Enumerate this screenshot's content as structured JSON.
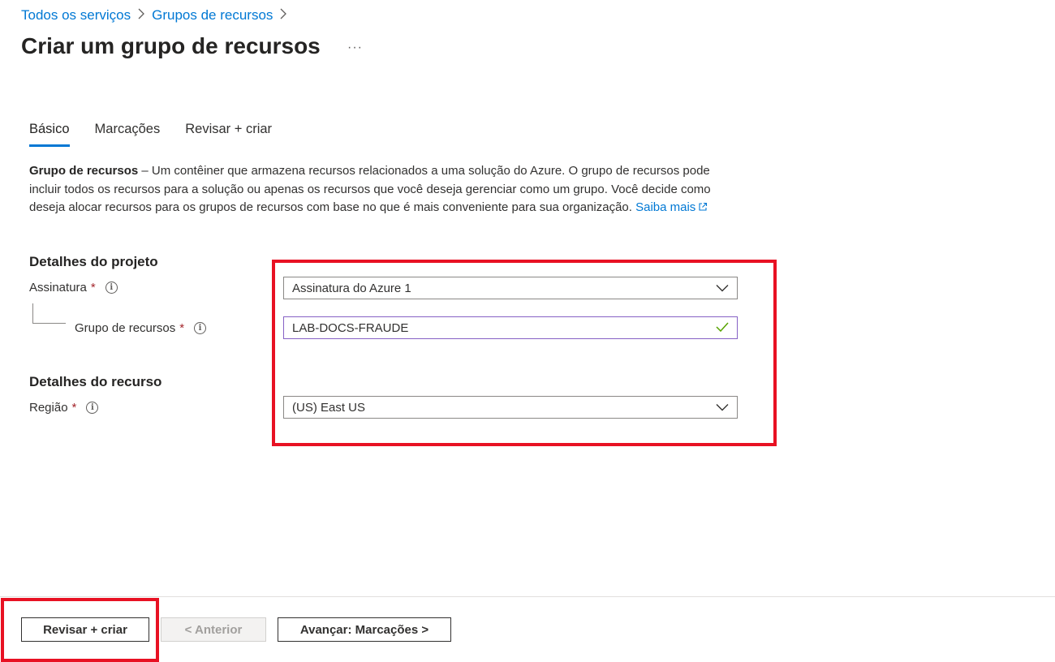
{
  "breadcrumb": [
    "Todos os serviços",
    "Grupos de recursos"
  ],
  "page": {
    "title": "Criar um grupo de recursos",
    "more_label": "···"
  },
  "tabs": [
    {
      "label": "Básico",
      "active": true
    },
    {
      "label": "Marcações",
      "active": false
    },
    {
      "label": "Revisar + criar",
      "active": false
    }
  ],
  "description": {
    "term": "Grupo de recursos",
    "text": " – Um contêiner que armazena recursos relacionados a uma solução do Azure. O grupo de recursos pode incluir todos os recursos para a solução ou apenas os recursos que você deseja gerenciar como um grupo. Você decide como deseja alocar recursos para os grupos de recursos com base no que é mais conveniente para sua organização.",
    "link": "Saiba mais"
  },
  "project_details": {
    "heading": "Detalhes do projeto",
    "subscription": {
      "label": "Assinatura",
      "required": "*",
      "value": "Assinatura do Azure 1"
    },
    "resource_group": {
      "label": "Grupo de recursos",
      "required": "*",
      "value": "LAB-DOCS-FRAUDE",
      "valid": true
    }
  },
  "resource_details": {
    "heading": "Detalhes do recurso",
    "region": {
      "label": "Região",
      "required": "*",
      "value": "(US) East US"
    }
  },
  "footer": {
    "review_create": "Revisar + criar",
    "previous": "< Anterior",
    "next": "Avançar: Marcações >"
  },
  "colors": {
    "accent": "#0078d4",
    "highlight": "#e81123",
    "required": "#a4262c",
    "valid_check": "#57a300",
    "focus_border": "#8661c5"
  },
  "icons": [
    "chevron-right-icon",
    "ellipsis-icon",
    "external-link-icon",
    "info-icon",
    "chevron-down-icon",
    "checkmark-icon"
  ]
}
